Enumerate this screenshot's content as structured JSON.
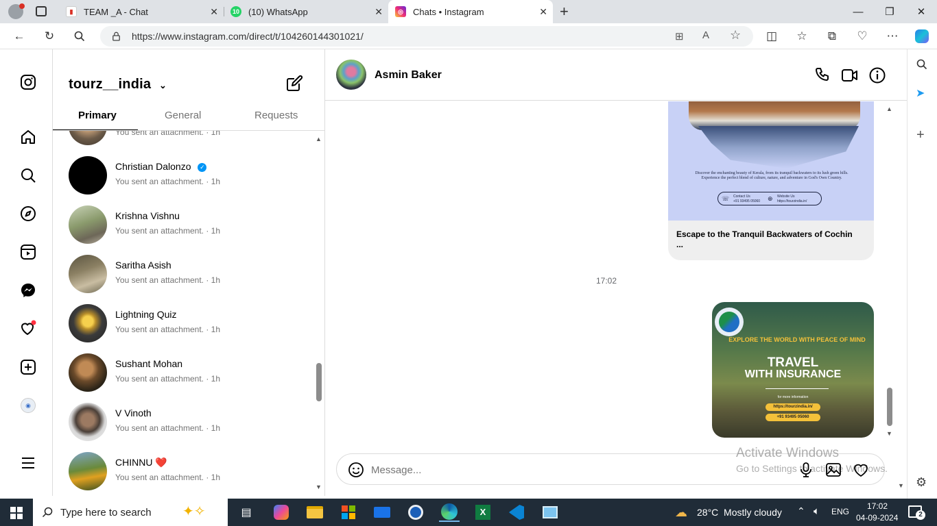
{
  "browser": {
    "tabs": [
      {
        "title": "TEAM _A - Chat",
        "active": false
      },
      {
        "title": "(10) WhatsApp",
        "active": false
      },
      {
        "title": "Chats • Instagram",
        "active": true
      }
    ],
    "new_tab_label": "+",
    "url": "https://www.instagram.com/direct/t/104260144301021/"
  },
  "inbox": {
    "username": "tourz__india",
    "tabs": [
      "Primary",
      "General",
      "Requests"
    ],
    "top_partial_sub": "You sent an attachment. · 1h",
    "conversations": [
      {
        "name": "Christian Dalonzo",
        "verified": true,
        "sub": "You sent an attachment. · 1h"
      },
      {
        "name": "Krishna Vishnu",
        "sub": "You sent an attachment. · 1h"
      },
      {
        "name": "Saritha Asish",
        "sub": "You sent an attachment. · 1h"
      },
      {
        "name": "Lightning Quiz",
        "sub": "You sent an attachment. · 1h"
      },
      {
        "name": "Sushant Mohan",
        "sub": "You sent an attachment. · 1h"
      },
      {
        "name": "V Vinoth",
        "sub": "You sent an attachment. · 1h"
      },
      {
        "name": "CHINNU ❤️",
        "sub": "You sent an attachment. · 1h"
      }
    ]
  },
  "chat": {
    "contact_name": "Asmin Baker",
    "post1": {
      "image_text": "Discover the enchanting beauty of Kerala, from its tranquil backwaters to its lush green hills. Experience the perfect blend of culture, nature, and adventure in God's Own Country.",
      "contact_phone_label": "Contact Us",
      "contact_phone": "+91 93495 05060",
      "website_label": "Website Us",
      "website": "https://tourzindia.in/",
      "caption": "Escape to the Tranquil Backwaters of Cochin",
      "caption_more": "..."
    },
    "timestamp": "17:02",
    "post2": {
      "headline": "EXPLORE THE WORLD WITH PEACE OF MIND",
      "title_line1": "TRAVEL",
      "title_line2": "WITH INSURANCE",
      "info_label": "for more information",
      "website": "https://tourzindia.in/",
      "phone": "+91 93495 05060"
    },
    "composer_placeholder": "Message...",
    "watermark_line1": "Activate Windows",
    "watermark_line2": "Go to Settings to activate Windows."
  },
  "taskbar": {
    "search_placeholder": "Type here to search",
    "weather": "28°C  Mostly cloudy",
    "language": "ENG",
    "time": "17:02",
    "date": "04-09-2024",
    "notifications": "2"
  }
}
